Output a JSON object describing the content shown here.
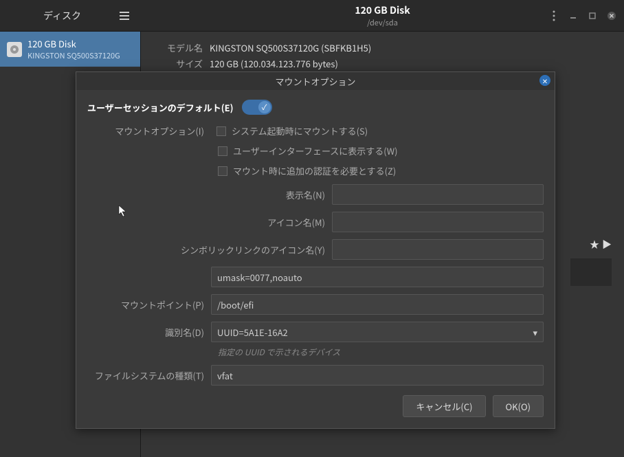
{
  "app": {
    "name": "ディスク"
  },
  "titlebar": {
    "title": "120 GB Disk",
    "subtitle": "/dev/sda"
  },
  "sidebar": {
    "disk": {
      "name": "120 GB Disk",
      "sub": "KINGSTON SQ500S37120G"
    }
  },
  "main": {
    "props": {
      "model_label": "モデル名",
      "model_value": "KINGSTON SQ500S37120G (SBFKB1H5)",
      "size_label": "サイズ",
      "size_value": "120 GB (120.034.123.776 bytes)"
    }
  },
  "modal": {
    "title": "マウントオプション",
    "session_default": "ユーザーセッションのデフォルト(E)",
    "mount_options_label": "マウントオプション(I)",
    "checks": {
      "boot": "システム起動時にマウントする(S)",
      "ui": "ユーザーインターフェースに表示する(W)",
      "auth": "マウント時に追加の認証を必要とする(Z)"
    },
    "display_name_label": "表示名(N)",
    "display_name": "",
    "icon_name_label": "アイコン名(M)",
    "icon_name": "",
    "symlink_label": "シンボリックリンクのアイコン名(Y)",
    "symlink": "",
    "options_value": "umask=0077,noauto",
    "mount_point_label": "マウントポイント(P)",
    "mount_point": "/boot/efi",
    "identify_label": "識別名(D)",
    "identify_value": "UUID=5A1E-16A2",
    "identify_hint": "指定の UUID で示されるデバイス",
    "fs_type_label": "ファイルシステムの種類(T)",
    "fs_type": "vfat",
    "cancel": "キャンセル(C)",
    "ok": "OK(O)"
  }
}
